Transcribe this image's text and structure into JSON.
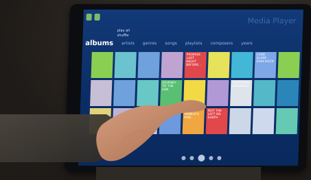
{
  "app": {
    "title": "Media Player"
  },
  "menu": {
    "items": [
      "play all",
      "shuffle"
    ]
  },
  "nav": {
    "current": "albums",
    "tabs": [
      "artists",
      "genres",
      "songs",
      "playlists",
      "composers",
      "years"
    ]
  },
  "tiles": [
    {
      "text": "",
      "color": "#8bcf52"
    },
    {
      "text": "",
      "color": "#6bc3cf"
    },
    {
      "text": "",
      "color": "#6fa1dc"
    },
    {
      "text": "",
      "color": "#bfa4d2"
    },
    {
      "text": "PROMISE LAST NIGHT BEFORE...",
      "color": "#e0474b"
    },
    {
      "text": "",
      "color": "#e6e35a"
    },
    {
      "text": "",
      "color": "#43b7d6"
    },
    {
      "text": "LAND SCAPE ZION ROCK",
      "color": "#7ea7e7"
    },
    {
      "text": "",
      "color": "#8bcf52"
    },
    {
      "text": "",
      "color": "#c7bfd6"
    },
    {
      "text": "",
      "color": "#6fa1dc"
    },
    {
      "text": "",
      "color": "#68c8c6"
    },
    {
      "text": "JOURNEY TO THE SUN",
      "color": "#59bf72"
    },
    {
      "text": "",
      "color": "#f2da45"
    },
    {
      "text": "",
      "color": "#b199d5"
    },
    {
      "text": "TIMESTAMP STANDARD",
      "color": "#dfe4ea"
    },
    {
      "text": "",
      "color": "#55b8c7"
    },
    {
      "text": "",
      "color": "#2a86b8"
    },
    {
      "text": "",
      "color": "#e1d37a"
    },
    {
      "text": "",
      "color": "#bdb4d3"
    },
    {
      "text": "",
      "color": "#c4c9e3"
    },
    {
      "text": "",
      "color": "#6e99dc"
    },
    {
      "text": "IT'S A PEBBLE'S PIRE",
      "color": "#f0a641"
    },
    {
      "text": "NOT THE LEFT ON EARTH",
      "color": "#e2474b"
    },
    {
      "text": "",
      "color": "#ccd8e8"
    },
    {
      "text": "",
      "color": "#cfd9ee"
    },
    {
      "text": "",
      "color": "#66c9b3"
    }
  ]
}
